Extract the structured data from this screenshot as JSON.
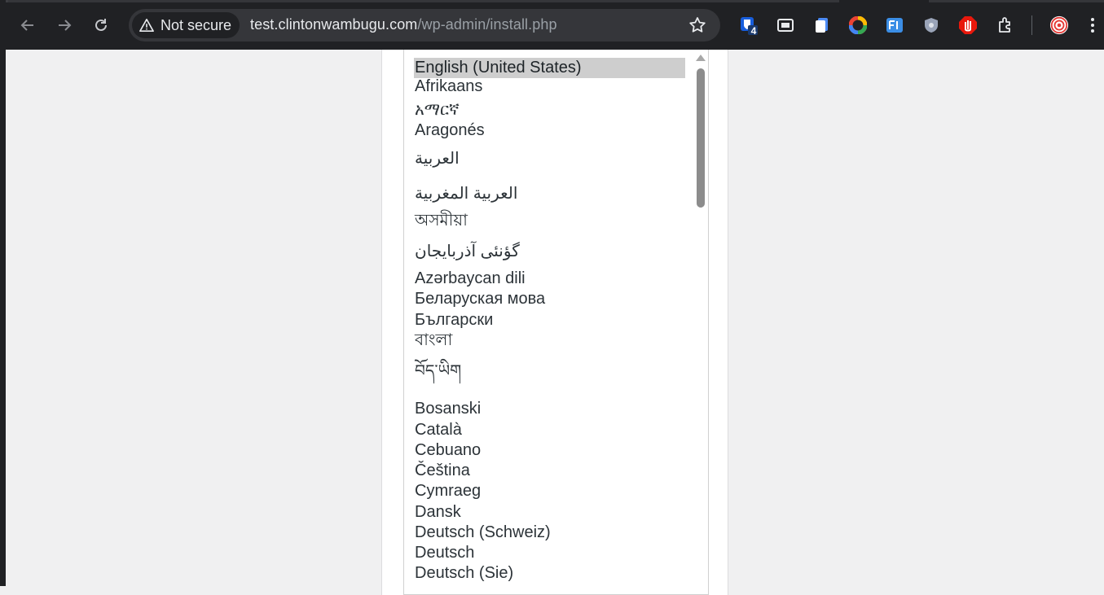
{
  "browser": {
    "security_label": "Not secure",
    "url_host": "test.clintonwambugu.com",
    "url_path": "/wp-admin/install.php",
    "icons": [
      "back-icon",
      "forward-icon",
      "reload-icon",
      "warning-icon",
      "star-icon",
      "extensions-icon",
      "menu-icon"
    ],
    "extension_badge": "4"
  },
  "language_select": {
    "selected": "English (United States)",
    "options": [
      "English (United States)",
      "Afrikaans",
      "አማርኛ",
      "Aragonés",
      "العربية",
      "العربية المغربية",
      "অসমীয়া",
      "گؤنئی آذربایجان",
      "Azərbaycan dili",
      "Беларуская мова",
      "Български",
      "বাংলা",
      "བོད་ཡིག",
      "Bosanski",
      "Català",
      "Cebuano",
      "Čeština",
      "Cymraeg",
      "Dansk",
      "Deutsch (Schweiz)",
      "Deutsch",
      "Deutsch (Sie)"
    ]
  }
}
